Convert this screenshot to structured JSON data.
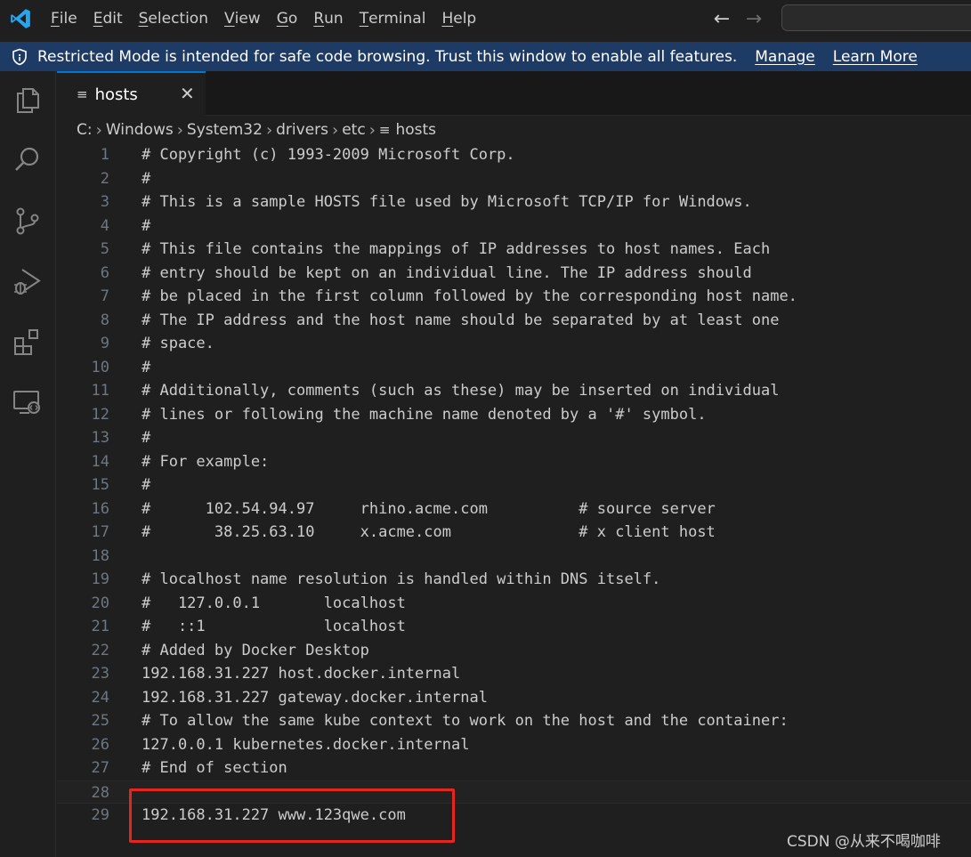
{
  "menu": [
    "File",
    "Edit",
    "Selection",
    "View",
    "Go",
    "Run",
    "Terminal",
    "Help"
  ],
  "menu_mnemonic": [
    "F",
    "E",
    "S",
    "V",
    "G",
    "R",
    "T",
    "H"
  ],
  "banner": {
    "text": "Restricted Mode is intended for safe code browsing. Trust this window to enable all features.",
    "manage": "Manage",
    "learn_more": "Learn More"
  },
  "tab": {
    "label": "hosts",
    "close": "✕"
  },
  "breadcrumb": [
    "C:",
    "Windows",
    "System32",
    "drivers",
    "etc",
    "hosts"
  ],
  "lines": [
    "# Copyright (c) 1993-2009 Microsoft Corp.",
    "#",
    "# This is a sample HOSTS file used by Microsoft TCP/IP for Windows.",
    "#",
    "# This file contains the mappings of IP addresses to host names. Each",
    "# entry should be kept on an individual line. The IP address should",
    "# be placed in the first column followed by the corresponding host name.",
    "# The IP address and the host name should be separated by at least one",
    "# space.",
    "#",
    "# Additionally, comments (such as these) may be inserted on individual",
    "# lines or following the machine name denoted by a '#' symbol.",
    "#",
    "# For example:",
    "#",
    "#      102.54.94.97     rhino.acme.com          # source server",
    "#       38.25.63.10     x.acme.com              # x client host",
    "",
    "# localhost name resolution is handled within DNS itself.",
    "#   127.0.0.1       localhost",
    "#   ::1             localhost",
    "# Added by Docker Desktop",
    "192.168.31.227 host.docker.internal",
    "192.168.31.227 gateway.docker.internal",
    "# To allow the same kube context to work on the host and the container:",
    "127.0.0.1 kubernetes.docker.internal",
    "# End of section",
    "",
    "192.168.31.227 www.123qwe.com"
  ],
  "current_line": 28,
  "watermark": "CSDN @从来不喝咖啡",
  "colors": {
    "accent": "#0078d4",
    "banner": "#1d3b65",
    "highlight": "#e5261e"
  }
}
